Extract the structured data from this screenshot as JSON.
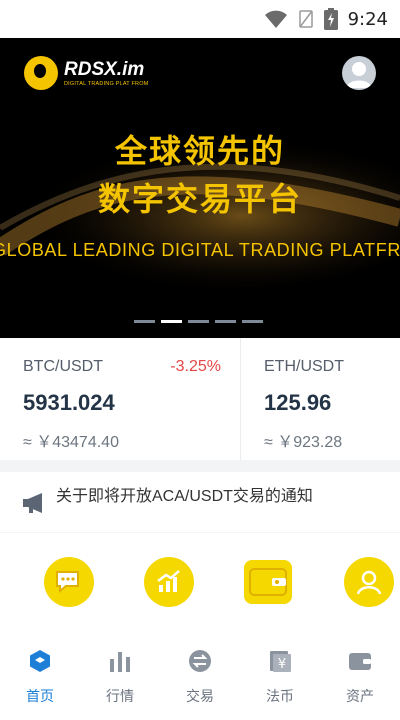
{
  "status_bar": {
    "time": "9:24"
  },
  "banner": {
    "brand_name": "RDSX.im",
    "brand_sub": "DIGITAL TRADING PLAT FROM",
    "headline_line1": "全球领先的",
    "headline_line2": "数字交易平台",
    "subline": "GLOBAL LEADING DIGITAL TRADING PLATFROM",
    "active_slide": 2,
    "slide_count": 5
  },
  "tickers": [
    {
      "pair": "BTC/USDT",
      "change": "-3.25%",
      "price": "5931.024",
      "approx": "≈ ￥43474.40"
    },
    {
      "pair": "ETH/USDT",
      "change": "",
      "price": "125.96",
      "approx": "≈ ￥923.28"
    }
  ],
  "notice": {
    "text": "关于即将开放ACA/USDT交易的通知"
  },
  "shortcuts": [
    {
      "icon": "chat-icon"
    },
    {
      "icon": "growth-chart-icon"
    },
    {
      "icon": "wallet-icon"
    },
    {
      "icon": "user-icon"
    }
  ],
  "tabs": [
    {
      "label": "首页",
      "icon": "home-cube-icon",
      "active": true
    },
    {
      "label": "行情",
      "icon": "bar-chart-icon",
      "active": false
    },
    {
      "label": "交易",
      "icon": "exchange-icon",
      "active": false
    },
    {
      "label": "法币",
      "icon": "fiat-yuan-icon",
      "active": false
    },
    {
      "label": "资产",
      "icon": "assets-wallet-icon",
      "active": false
    }
  ],
  "colors": {
    "accent_yellow": "#f5d800",
    "tab_active": "#1d7fd6",
    "negative": "#e44747",
    "banner_bg": "#000000"
  }
}
